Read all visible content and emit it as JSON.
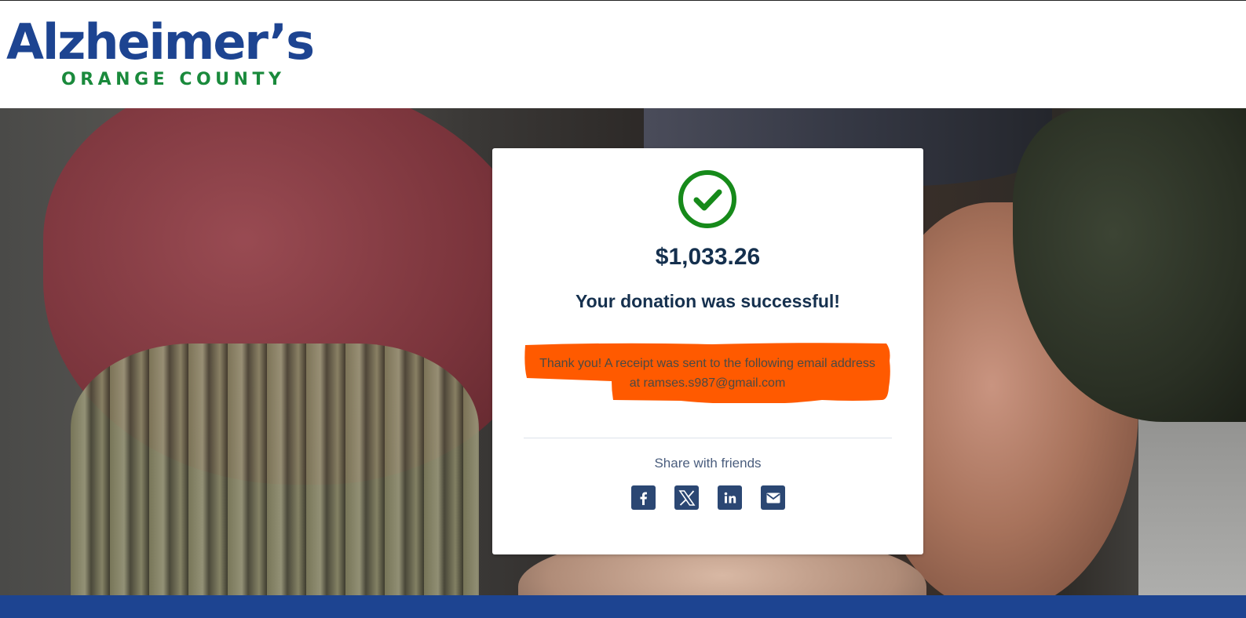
{
  "header": {
    "logo_main": "Alzheimer’s",
    "logo_sub": "ORANGE COUNTY"
  },
  "confirmation": {
    "amount": "$1,033.26",
    "headline": "Your donation was successful!",
    "receipt_line1": "Thank you! A receipt was sent to the following email address",
    "receipt_line2": "at ramses.s987@gmail.com",
    "share_label": "Share with friends"
  },
  "share_buttons": [
    {
      "icon": "facebook-icon"
    },
    {
      "icon": "x-twitter-icon"
    },
    {
      "icon": "linkedin-icon"
    },
    {
      "icon": "email-icon"
    }
  ],
  "colors": {
    "brand_blue": "#1d4491",
    "brand_green": "#1a8a3c",
    "success_green": "#168a1a",
    "heading_navy": "#15304e",
    "highlight_orange": "#ff5a00",
    "share_button": "#2b4773"
  }
}
